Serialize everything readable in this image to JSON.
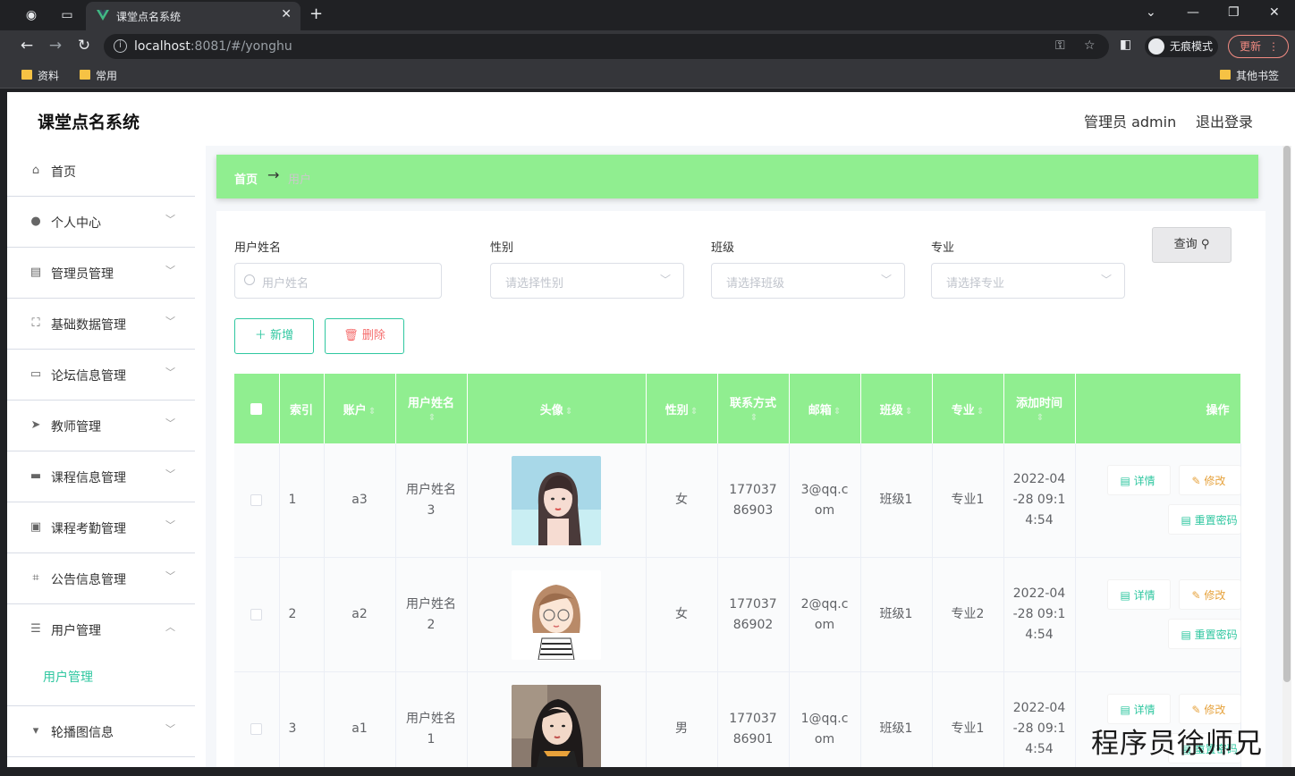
{
  "browser": {
    "tab_title": "课堂点名系统",
    "url_host": "localhost",
    "url_rest": ":8081/#/yonghu",
    "incognito_label": "无痕模式",
    "update_label": "更新",
    "bookmarks": [
      "资料",
      "常用"
    ],
    "other_bookmarks": "其他书签"
  },
  "app": {
    "title": "课堂点名系统",
    "user_label": "管理员 admin",
    "logout_label": "退出登录"
  },
  "sidebar": {
    "items": [
      {
        "label": "首页",
        "icon": "home-icon"
      },
      {
        "label": "个人中心",
        "icon": "user-icon"
      },
      {
        "label": "管理员管理",
        "icon": "id-card-icon"
      },
      {
        "label": "基础数据管理",
        "icon": "frame-icon"
      },
      {
        "label": "论坛信息管理",
        "icon": "chat-icon"
      },
      {
        "label": "教师管理",
        "icon": "send-icon"
      },
      {
        "label": "课程信息管理",
        "icon": "briefcase-icon"
      },
      {
        "label": "课程考勤管理",
        "icon": "clipboard-icon"
      },
      {
        "label": "公告信息管理",
        "icon": "crop-icon"
      },
      {
        "label": "用户管理",
        "icon": "list-icon"
      },
      {
        "label": "轮播图信息",
        "icon": "board-icon"
      }
    ],
    "sub_active": "用户管理"
  },
  "breadcrumb": {
    "home": "首页",
    "separator": "→",
    "current": "用户"
  },
  "filters": {
    "name_label": "用户姓名",
    "name_placeholder": "用户姓名",
    "gender_label": "性别",
    "gender_placeholder": "请选择性别",
    "class_label": "班级",
    "class_placeholder": "请选择班级",
    "major_label": "专业",
    "major_placeholder": "请选择专业",
    "query_label": "查询"
  },
  "actions": {
    "add_label": "新增",
    "delete_label": "删除"
  },
  "table": {
    "headers": {
      "index": "索引",
      "account": "账户",
      "name": "用户姓名",
      "avatar": "头像",
      "gender": "性别",
      "phone": "联系方式",
      "email": "邮箱",
      "class": "班级",
      "major": "专业",
      "added": "添加时间",
      "ops": "操作"
    },
    "rows": [
      {
        "index": "1",
        "account": "a3",
        "name": "用户姓名3",
        "gender": "女",
        "phone": "17703786903",
        "email": "3@qq.com",
        "class": "班级1",
        "major": "专业1",
        "added": "2022-04-28 09:14:54"
      },
      {
        "index": "2",
        "account": "a2",
        "name": "用户姓名2",
        "gender": "女",
        "phone": "17703786902",
        "email": "2@qq.com",
        "class": "班级1",
        "major": "专业2",
        "added": "2022-04-28 09:14:54"
      },
      {
        "index": "3",
        "account": "a1",
        "name": "用户姓名1",
        "gender": "男",
        "phone": "17703786901",
        "email": "1@qq.com",
        "class": "班级1",
        "major": "专业1",
        "added": "2022-04-28 09:14:54"
      }
    ],
    "op_labels": {
      "detail": "详情",
      "edit": "修改",
      "reset": "重置密码"
    }
  },
  "watermark": "程序员徐师兄",
  "colors": {
    "accent": "#2fc7a0",
    "header_green": "#90ee90",
    "danger": "#f56c6c",
    "warning": "#e6a23c"
  }
}
